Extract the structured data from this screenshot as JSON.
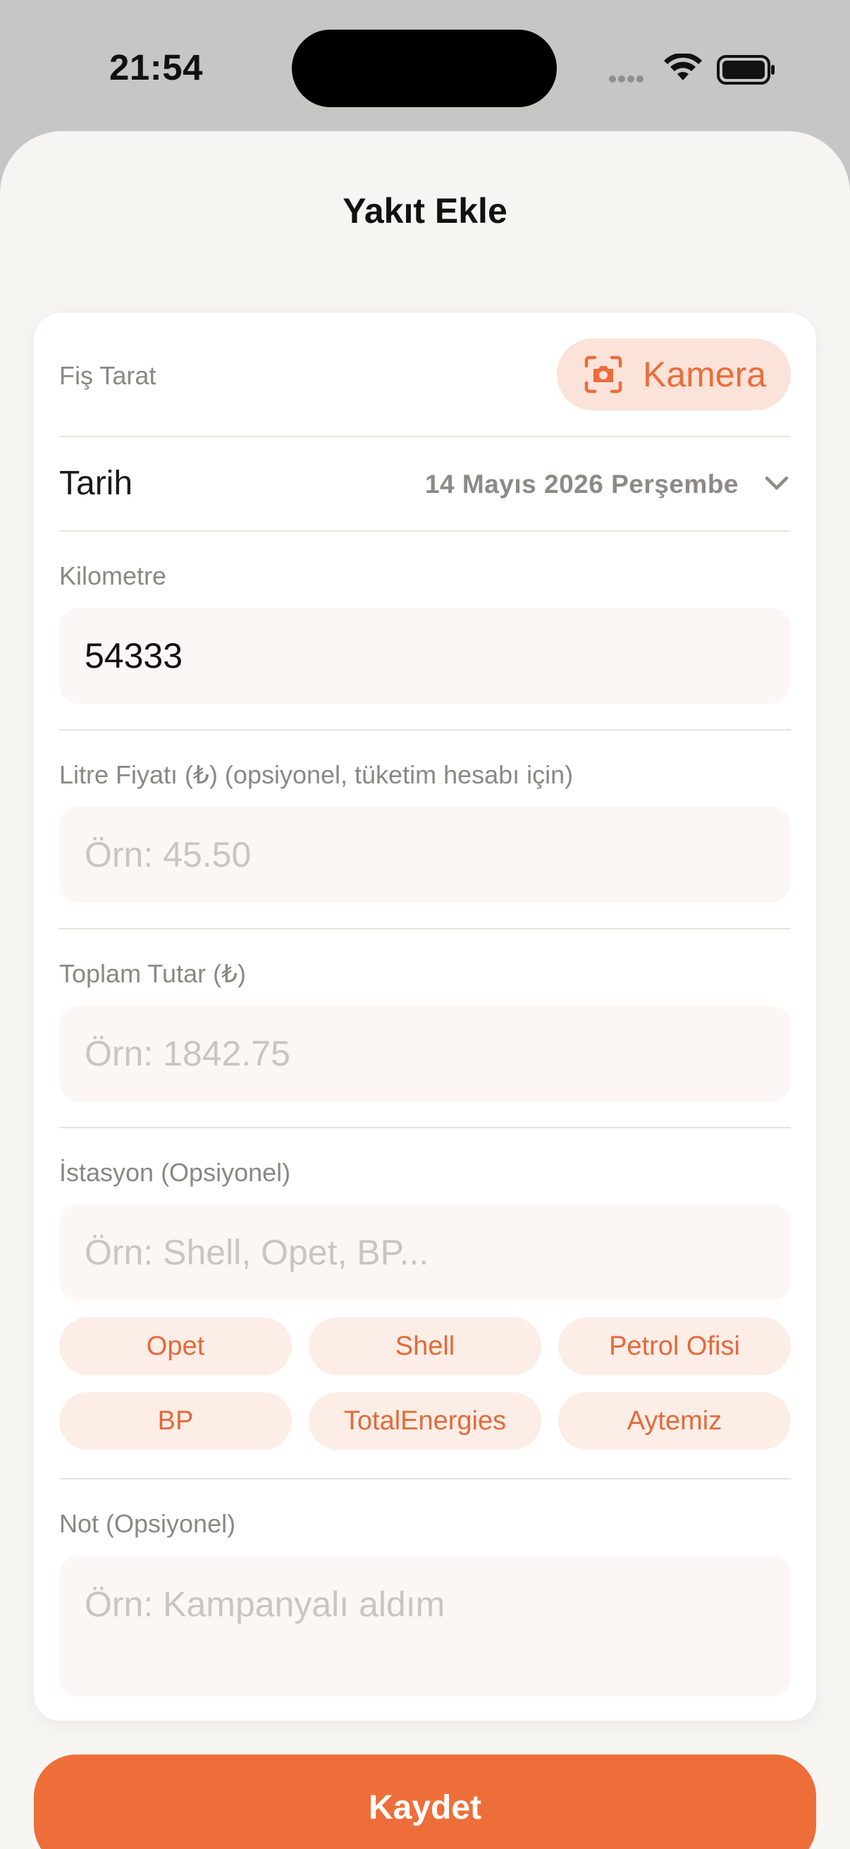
{
  "status_bar": {
    "time": "21:54"
  },
  "sheet": {
    "title": "Yakıt Ekle"
  },
  "scan": {
    "label": "Fiş Tarat",
    "camera_label": "Kamera"
  },
  "date": {
    "label": "Tarih",
    "value": "14 Mayıs 2026 Perşembe"
  },
  "odometer": {
    "label": "Kilometre",
    "value": "54333"
  },
  "price_per_liter": {
    "label": "Litre Fiyatı (₺) (opsiyonel, tüketim hesabı için)",
    "placeholder": "Örn: 45.50"
  },
  "total": {
    "label": "Toplam Tutar (₺)",
    "placeholder": "Örn: 1842.75"
  },
  "station": {
    "label": "İstasyon (Opsiyonel)",
    "placeholder": "Örn: Shell, Opet, BP...",
    "chips": [
      "Opet",
      "Shell",
      "Petrol Ofisi",
      "BP",
      "TotalEnergies",
      "Aytemiz"
    ]
  },
  "note": {
    "label": "Not (Opsiyonel)",
    "placeholder": "Örn: Kampanyalı aldım"
  },
  "save_label": "Kaydet",
  "colors": {
    "accent": "#ee6e3a",
    "chip_bg": "#fcede6",
    "field_bg": "#fcf7f4"
  }
}
